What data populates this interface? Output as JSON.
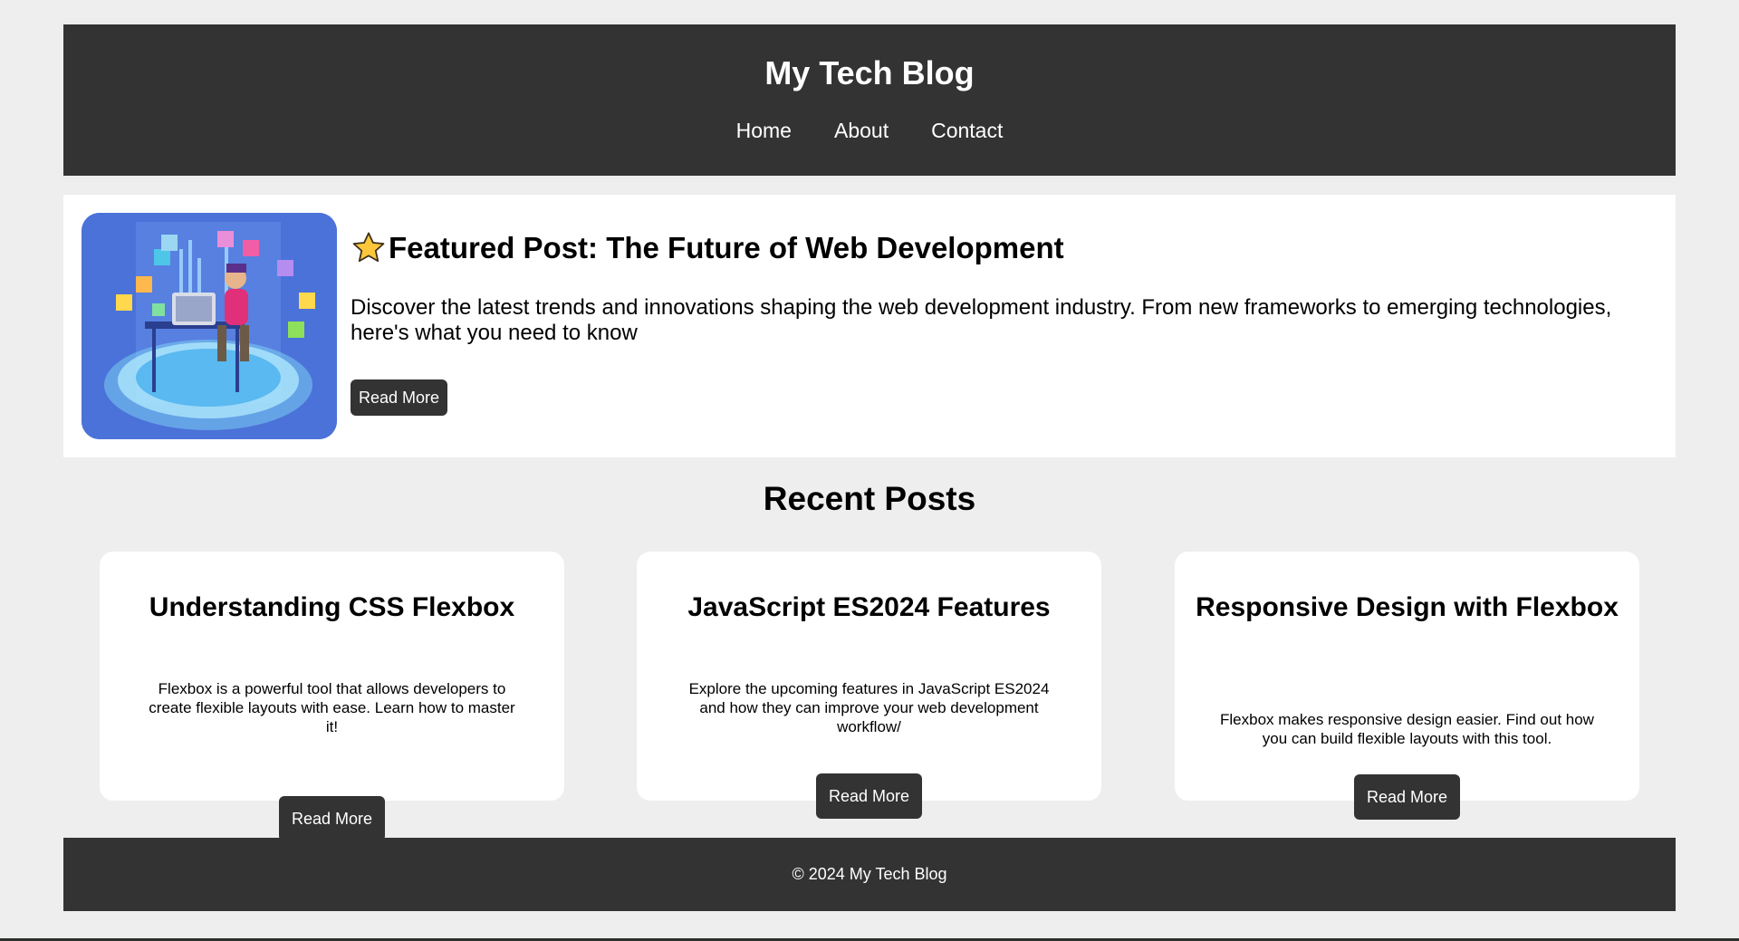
{
  "header": {
    "title": "My Tech Blog",
    "nav": [
      "Home",
      "About",
      "Contact"
    ]
  },
  "featured": {
    "title": "Featured Post: The Future of Web Development",
    "icon": "star-icon",
    "description": "Discover the latest trends and innovations shaping the web development industry. From new frameworks to emerging technologies, here's what you need to know",
    "button": "Read More"
  },
  "recent": {
    "heading": "Recent Posts",
    "posts": [
      {
        "title": "Understanding CSS Flexbox",
        "text": "Flexbox is a powerful tool that allows developers to create flexible layouts with ease. Learn how to master it!",
        "button": "Read More"
      },
      {
        "title": "JavaScript ES2024 Features",
        "text": "Explore the upcoming features in JavaScript ES2024 and how they can improve your web development workflow/",
        "button": "Read More"
      },
      {
        "title": "Responsive Design with Flexbox",
        "text": "Flexbox makes responsive design easier. Find out how you can build flexible layouts with this tool.",
        "button": "Read More"
      }
    ]
  },
  "footer": {
    "text": "© 2024 My Tech Blog"
  },
  "colors": {
    "header_bg": "#333333",
    "page_bg": "#eeeeee",
    "button_bg": "#333333"
  }
}
